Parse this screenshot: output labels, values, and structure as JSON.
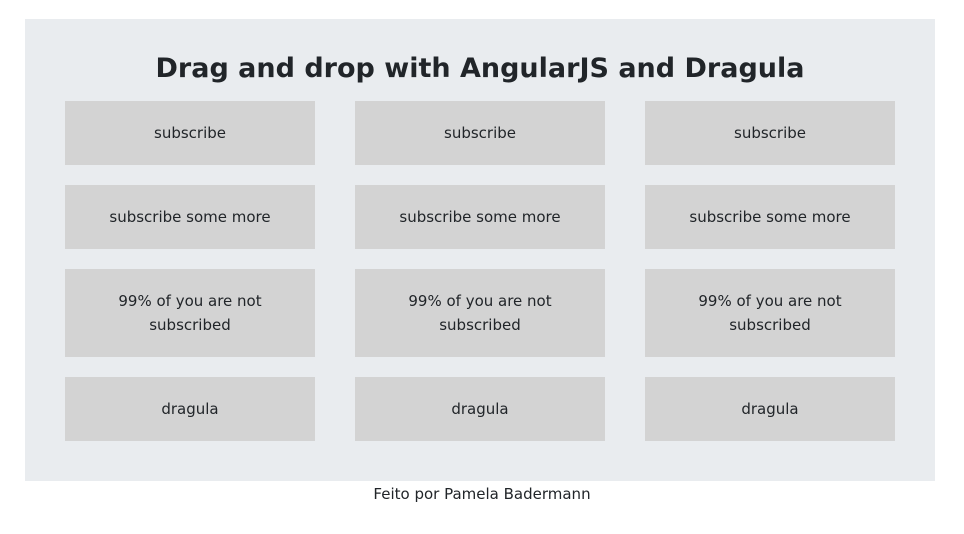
{
  "header": {
    "title": "Drag and drop with AngularJS and Dragula"
  },
  "columns": [
    {
      "cards": [
        "subscribe",
        "subscribe some more",
        "99% of you are not subscribed",
        "dragula"
      ]
    },
    {
      "cards": [
        "subscribe",
        "subscribe some more",
        "99% of you are not subscribed",
        "dragula"
      ]
    },
    {
      "cards": [
        "subscribe",
        "subscribe some more",
        "99% of you are not subscribed",
        "dragula"
      ]
    }
  ],
  "footer": {
    "text": "Feito por Pamela Badermann"
  },
  "colors": {
    "page_background": "#ffffff",
    "container_background": "#e9ecef",
    "card_background": "#d3d3d3",
    "text": "#212529"
  }
}
